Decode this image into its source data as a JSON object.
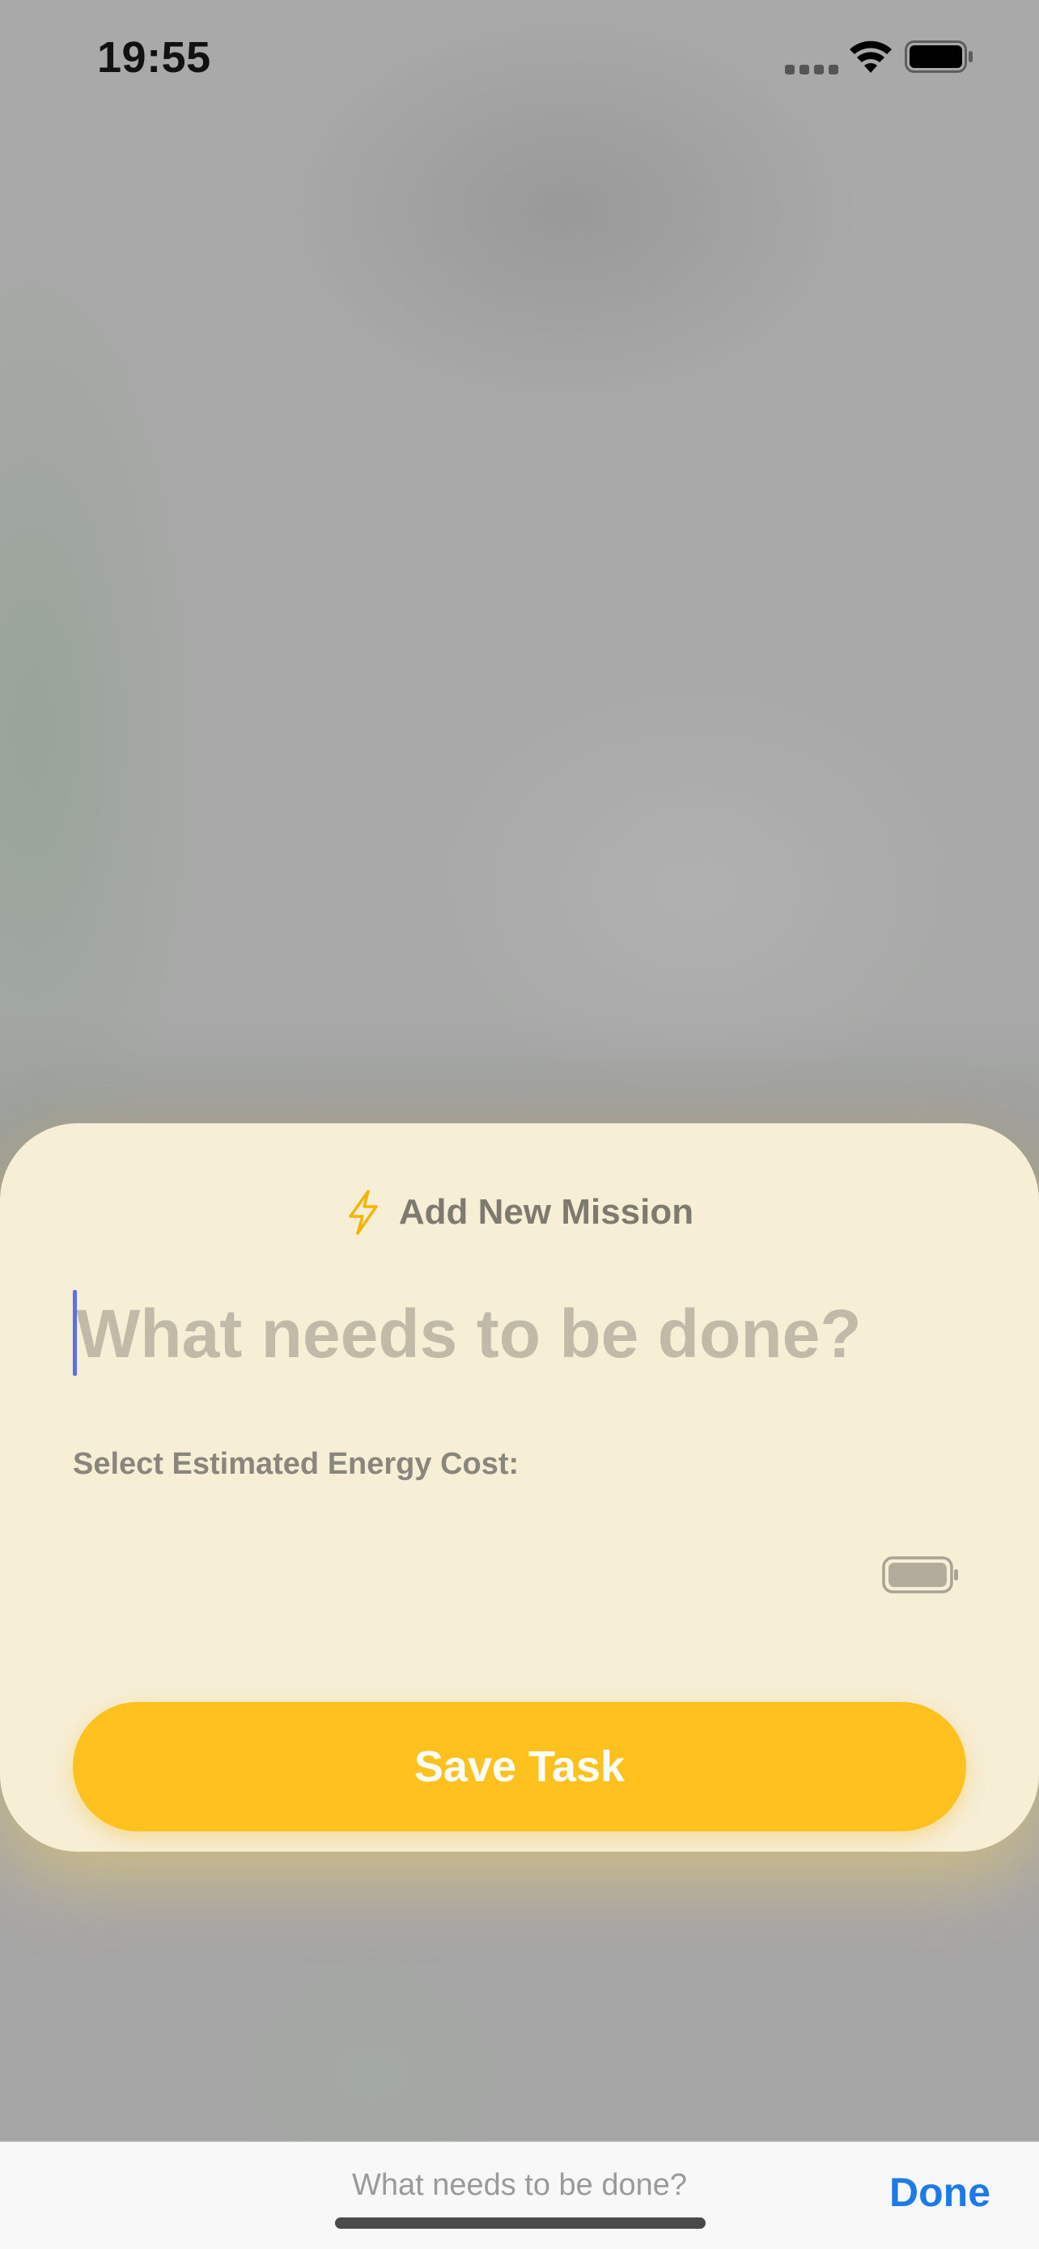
{
  "status_bar": {
    "time": "19:55",
    "signal_icon": "cellular-signal-icon",
    "wifi_icon": "wifi-icon",
    "battery_icon": "battery-full-icon"
  },
  "sheet": {
    "header_icon": "lightning-bolt-icon",
    "title": "Add New Mission",
    "task_input": {
      "value": "",
      "placeholder": "What needs to be done?"
    },
    "energy_label": "Select Estimated Energy Cost:",
    "energy_icon": "battery-icon",
    "save_label": "Save Task"
  },
  "keyboard_accessory": {
    "preview_text": "What needs to be done?",
    "done_label": "Done"
  },
  "colors": {
    "accent": "#fec11e",
    "sheet_background": "#f7eed6",
    "done": "#1e7ae6",
    "cursor": "#5b6ef0"
  }
}
